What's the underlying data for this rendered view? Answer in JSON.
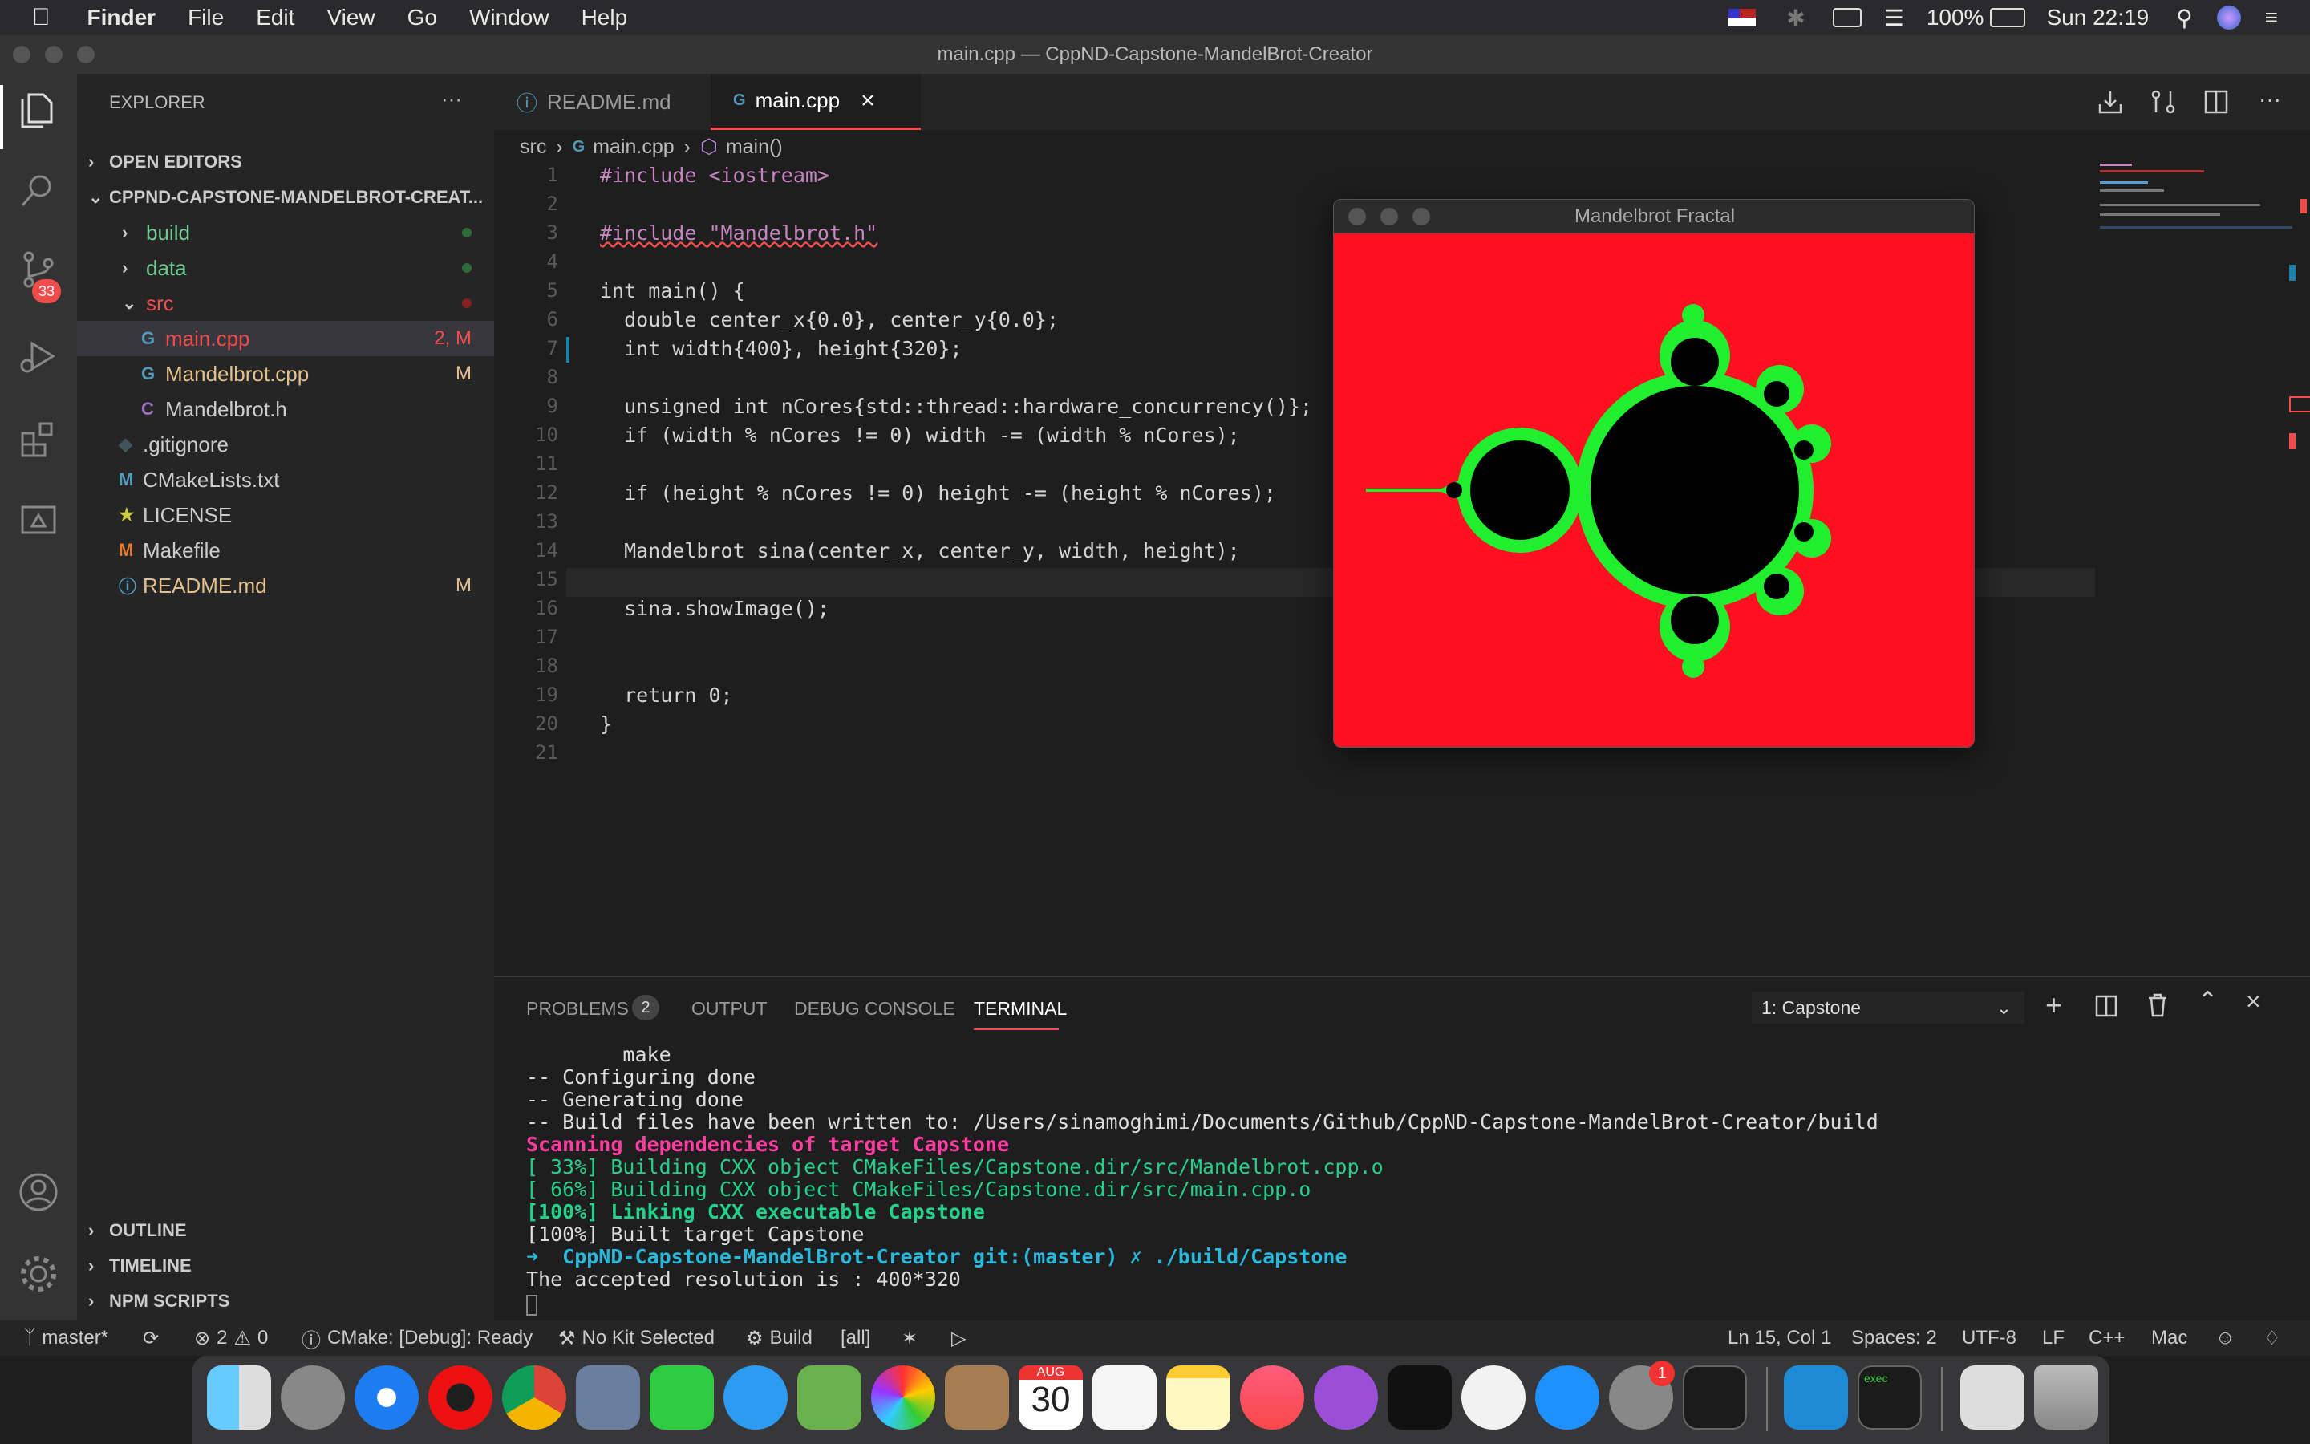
{
  "menubar": {
    "app": "Finder",
    "items": [
      "File",
      "Edit",
      "View",
      "Go",
      "Window",
      "Help"
    ],
    "battery": "100%",
    "clock": "Sun 22:19"
  },
  "window": {
    "title": "main.cpp — CppND-Capstone-MandelBrot-Creator"
  },
  "activity": {
    "scm_badge": "33"
  },
  "explorer": {
    "title": "EXPLORER",
    "more": "···",
    "open_editors": "OPEN EDITORS",
    "project": "CPPND-CAPSTONE-MANDELBROT-CREAT...",
    "tree": [
      {
        "label": "build",
        "kind": "folder",
        "decor": "dot-green"
      },
      {
        "label": "data",
        "kind": "folder",
        "decor": "dot-green"
      },
      {
        "label": "src",
        "kind": "folder-open",
        "decor": "dot-red"
      },
      {
        "label": "main.cpp",
        "kind": "cpp",
        "decor": "2, M"
      },
      {
        "label": "Mandelbrot.cpp",
        "kind": "cpp",
        "decor": "M"
      },
      {
        "label": "Mandelbrot.h",
        "kind": "h",
        "decor": ""
      },
      {
        "label": ".gitignore",
        "kind": "git",
        "decor": ""
      },
      {
        "label": "CMakeLists.txt",
        "kind": "m",
        "decor": ""
      },
      {
        "label": "LICENSE",
        "kind": "license",
        "decor": ""
      },
      {
        "label": "Makefile",
        "kind": "make",
        "decor": ""
      },
      {
        "label": "README.md",
        "kind": "info",
        "decor": "M"
      }
    ],
    "outline": "OUTLINE",
    "timeline": "TIMELINE",
    "npm": "NPM SCRIPTS"
  },
  "tabs": [
    {
      "label": "README.md"
    },
    {
      "label": "main.cpp",
      "close": "×"
    }
  ],
  "breadcrumb": {
    "folder": "src",
    "file": "main.cpp",
    "symbol": "main()"
  },
  "code": {
    "line_numbers": [
      "1",
      "2",
      "3",
      "4",
      "5",
      "6",
      "7",
      "8",
      "9",
      "10",
      "11",
      "12",
      "13",
      "14",
      "15",
      "16",
      "17",
      "18",
      "19",
      "20",
      "21"
    ],
    "lines": [
      "#include <iostream>",
      "",
      "#include \"Mandelbrot.h\"",
      "",
      "int main() {",
      "  double center_x{0.0}, center_y{0.0};",
      "  int width{400}, height{320};",
      "",
      "  unsigned int nCores{std::thread::hardware_concurrency()};",
      "  if (width % nCores != 0) width -= (width % nCores);",
      "",
      "  if (height % nCores != 0) height -= (height % nCores);",
      "",
      "  Mandelbrot sina(center_x, center_y, width, height);",
      "",
      "  sina.showImage();",
      "",
      "",
      "  return 0;",
      "}",
      ""
    ]
  },
  "mandel_window": {
    "title": "Mandelbrot Fractal"
  },
  "panel": {
    "tabs": [
      "PROBLEMS",
      "OUTPUT",
      "DEBUG CONSOLE",
      "TERMINAL"
    ],
    "problems_count": "2",
    "terminal_select": "1: Capstone",
    "lines": [
      "        make",
      "-- Configuring done",
      "-- Generating done",
      "-- Build files have been written to: /Users/sinamoghimi/Documents/Github/CppND-Capstone-MandelBrot-Creator/build",
      "Scanning dependencies of target Capstone",
      "[ 33%] Building CXX object CMakeFiles/Capstone.dir/src/Mandelbrot.cpp.o",
      "[ 66%] Building CXX object CMakeFiles/Capstone.dir/src/main.cpp.o",
      "[100%] Linking CXX executable Capstone",
      "[100%] Built target Capstone",
      "➜  CppND-Capstone-MandelBrot-Creator git:(master) ✗ ./build/Capstone",
      "The accepted resolution is : 400*320"
    ]
  },
  "status": {
    "branch": "master*",
    "errors": "2",
    "warnings": "0",
    "cmake": "CMake: [Debug]: Ready",
    "kit": "No Kit Selected",
    "build": "Build",
    "target": "[all]",
    "position": "Ln 15, Col 1",
    "spaces": "Spaces: 2",
    "encoding": "UTF-8",
    "eol": "LF",
    "lang": "C++",
    "platform": "Mac"
  },
  "dock": {
    "calendar_month": "AUG",
    "calendar_day": "30",
    "prefs_badge": "1",
    "exec_label": "exec"
  },
  "colors": {
    "accent_red": "#f14c4c",
    "modified": "#e2c08d",
    "green_dot": "#2ea043",
    "keyword": "#569cd6",
    "string": "#ce9178",
    "terminal_pink": "#ff3fa0",
    "terminal_green": "#23d18b",
    "terminal_cyan": "#29b8db"
  }
}
